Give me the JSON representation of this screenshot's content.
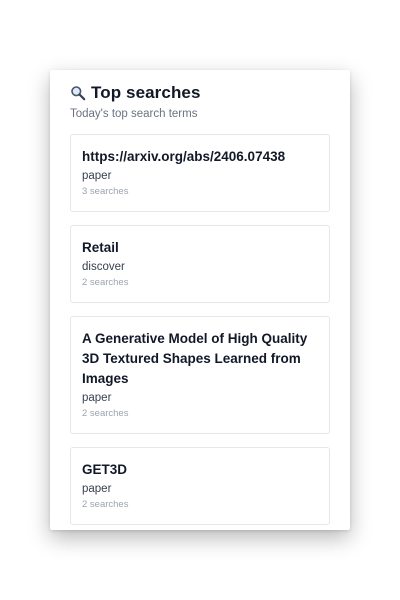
{
  "panel": {
    "icon": "magnifying-glass-icon",
    "title": "Top searches",
    "subtitle": "Today's top search terms"
  },
  "items": [
    {
      "title": "https://arxiv.org/abs/2406.07438",
      "category": "paper",
      "count": "3 searches"
    },
    {
      "title": "Retail",
      "category": "discover",
      "count": "2 searches"
    },
    {
      "title": "A Generative Model of High Quality 3D Textured Shapes Learned from Images",
      "category": "paper",
      "count": "2 searches"
    },
    {
      "title": "GET3D",
      "category": "paper",
      "count": "2 searches"
    }
  ]
}
